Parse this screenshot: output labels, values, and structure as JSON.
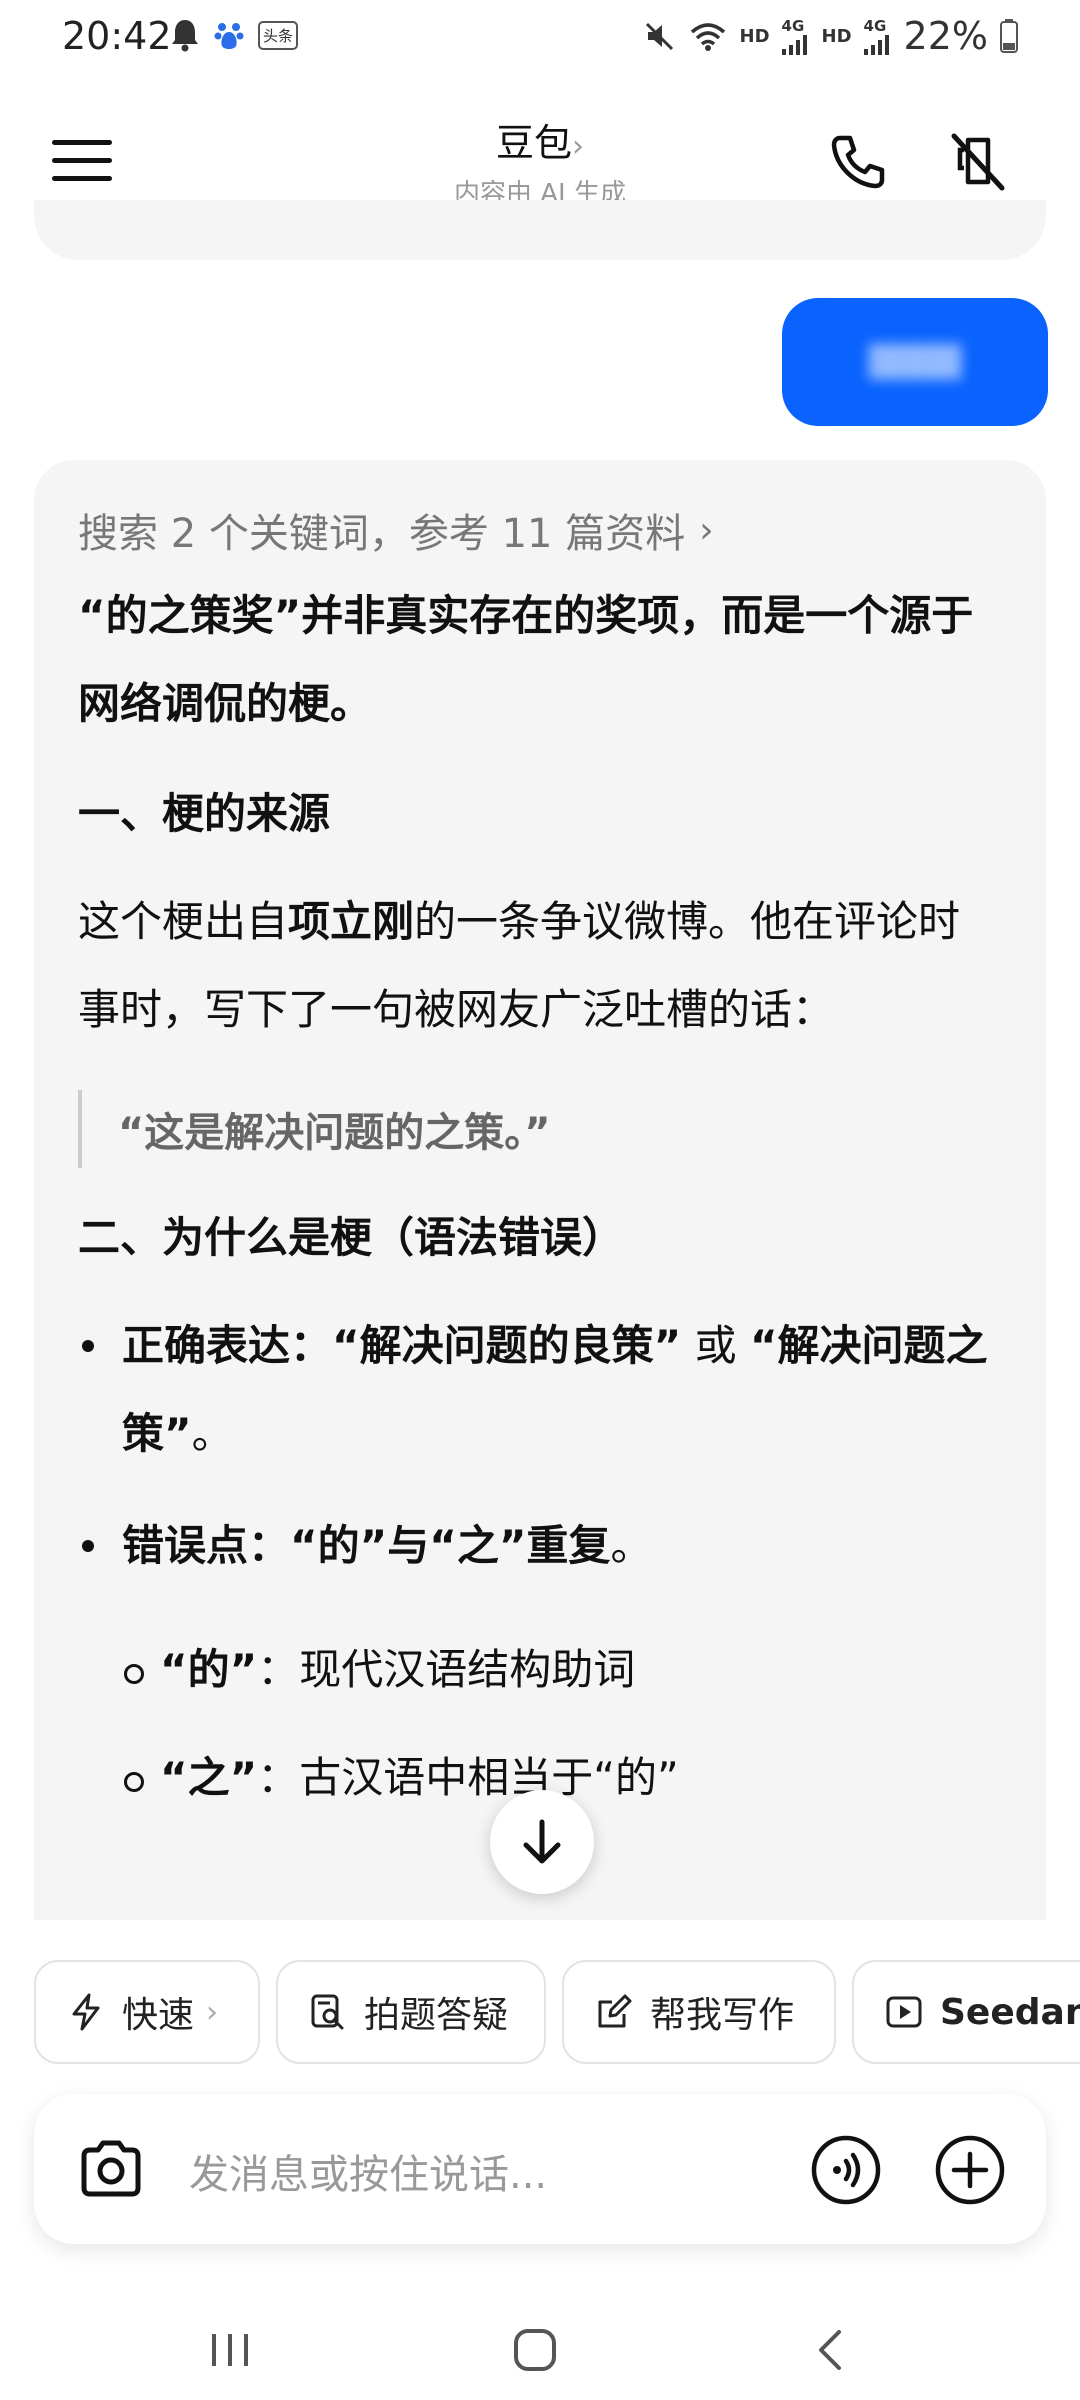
{
  "status_bar": {
    "time": "20:42",
    "badge_text": "头条",
    "hd1": "HD",
    "net1": "4G",
    "hd2": "HD",
    "net2": "4G",
    "battery": "22%"
  },
  "header": {
    "title": "豆包",
    "subtitle": "内容由 AI 生成"
  },
  "answer": {
    "search_ref": "搜索 2 个关键词，参考 11 篇资料",
    "intro": "“的之策奖”并非真实存在的奖项，而是一个源于网络调侃的梗。",
    "h1": "一、梗的来源",
    "p1_a": "这个梗出自",
    "p1_b": "项立刚",
    "p1_c": "的一条争议微博。他在评论时事时，写下了一句被网友广泛吐槽的话：",
    "quote": "“这是解决问题的之策。”",
    "h2": "二、为什么是梗（语法错误）",
    "bullet1_label": "正确表达",
    "bullet1_text": "：“解决问题的良策”",
    "bullet1_or": " 或 ",
    "bullet1_text2": "“解决问题之策”",
    "bullet1_end": "。",
    "bullet2_label": "错误点",
    "bullet2_text": "：“的”与“之”重复",
    "bullet2_end": "。",
    "sub1_label": "“的”",
    "sub1_text": "：现代汉语结构助词",
    "sub2_label": "“之”",
    "sub2_text": "：古汉语中相当于“的”"
  },
  "chips": [
    {
      "label": "快速",
      "icon": "bolt-icon"
    },
    {
      "label": "拍题答疑",
      "icon": "scan-doc-icon"
    },
    {
      "label": "帮我写作",
      "icon": "edit-icon"
    },
    {
      "label": "Seedan",
      "icon": "play-icon"
    }
  ],
  "input": {
    "placeholder": "发消息或按住说话..."
  },
  "colors": {
    "accent": "#0a63ff",
    "card_bg": "#f5f5f5"
  }
}
